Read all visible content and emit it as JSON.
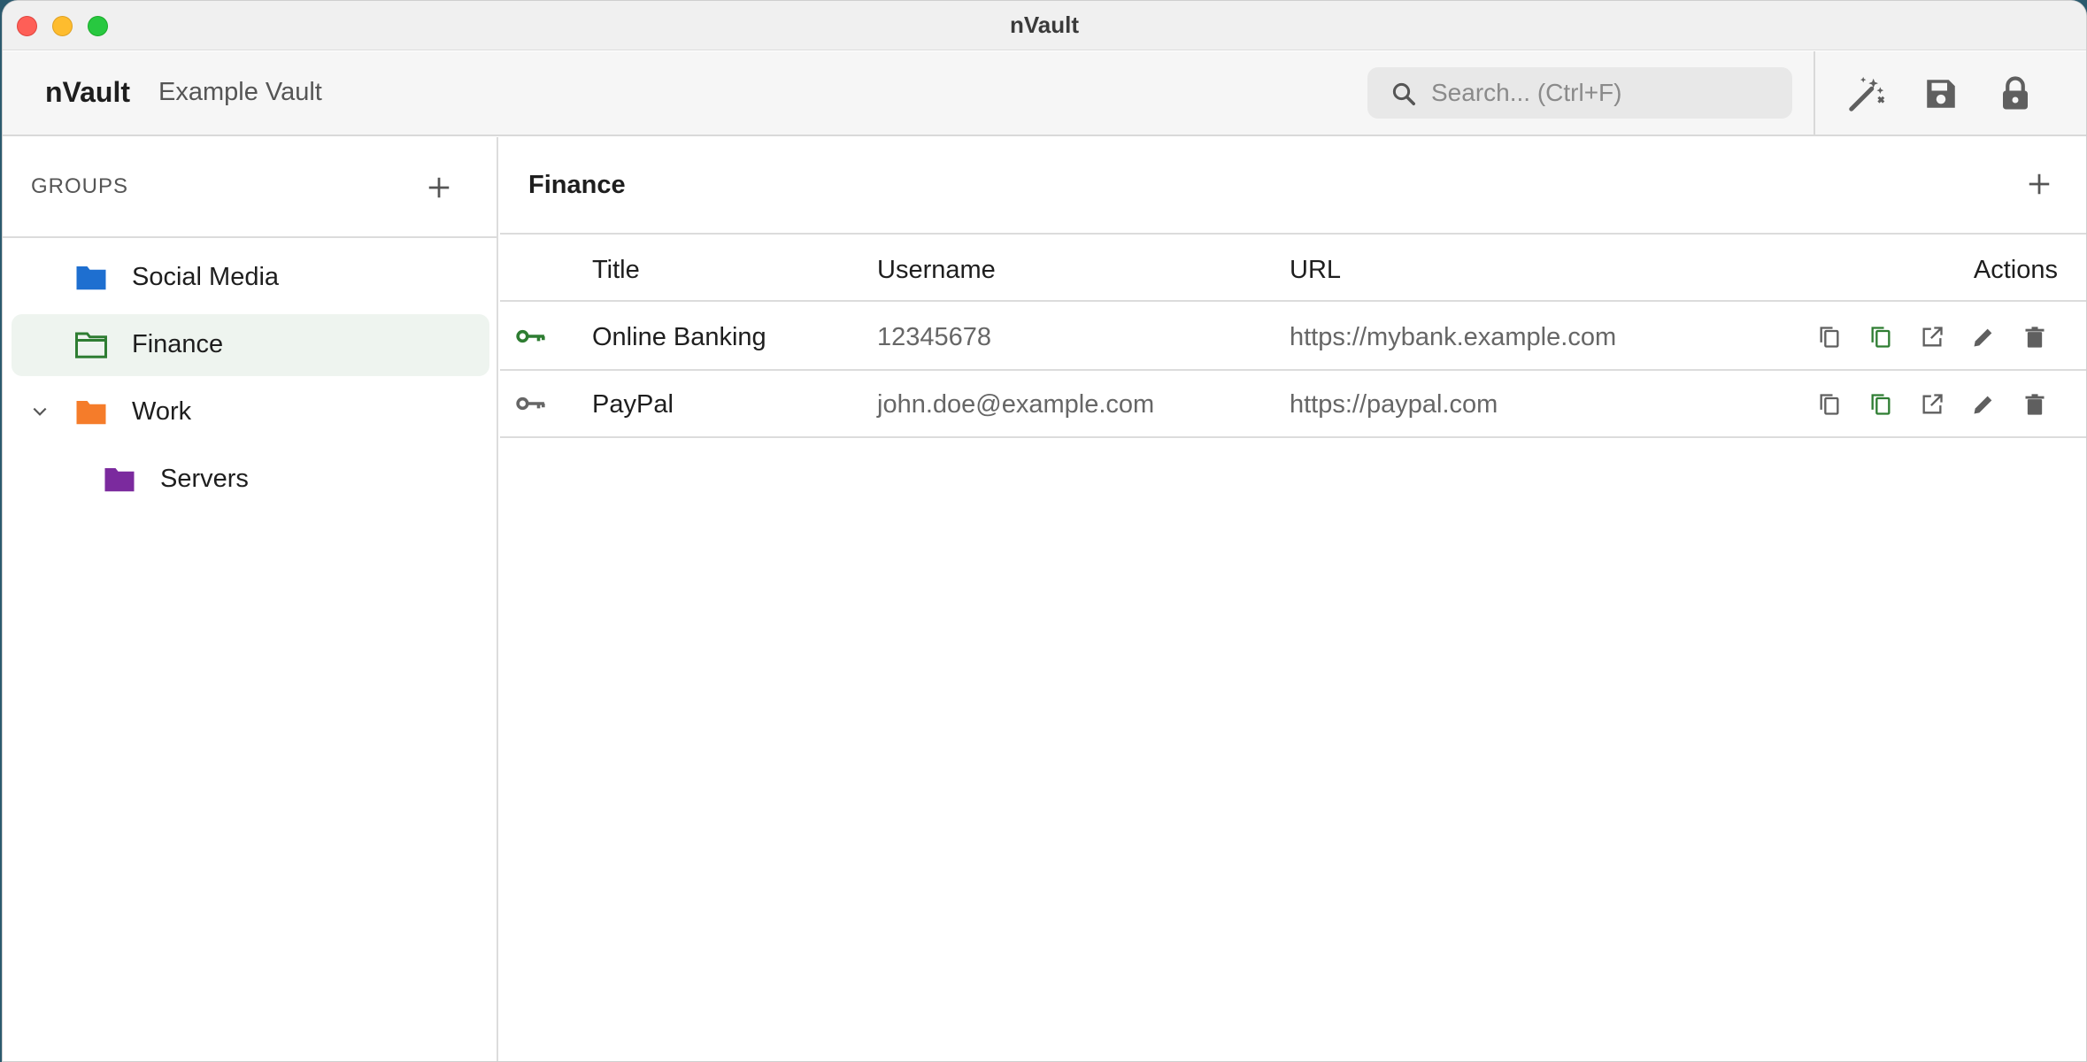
{
  "window": {
    "title": "nVault"
  },
  "header": {
    "app_name": "nVault",
    "vault_name": "Example Vault",
    "search_placeholder": "Search... (Ctrl+F)",
    "actions": [
      "magic-wand-icon",
      "save-icon",
      "lock-icon"
    ]
  },
  "sidebar": {
    "heading": "GROUPS",
    "groups": [
      {
        "label": "Social Media",
        "color": "#1e6fd0"
      },
      {
        "label": "Finance",
        "color": "#2e7d32",
        "selected": true
      },
      {
        "label": "Work",
        "color": "#f57c2a",
        "expanded": true
      },
      {
        "label": "Servers",
        "color": "#7b2a9e"
      }
    ]
  },
  "main": {
    "title": "Finance",
    "columns": {
      "title": "Title",
      "username": "Username",
      "url": "URL",
      "actions": "Actions"
    },
    "rows": [
      {
        "title": "Online Banking",
        "username": "12345678",
        "url": "https://mybank.example.com",
        "key_color": "#2e7d32"
      },
      {
        "title": "PayPal",
        "username": "john.doe@example.com",
        "url": "https://paypal.com",
        "key_color": "#666666"
      }
    ]
  },
  "colors": {
    "accent": "#2e7d32",
    "selected_bg": "#eef4ef",
    "icon": "#5f5f5f"
  }
}
